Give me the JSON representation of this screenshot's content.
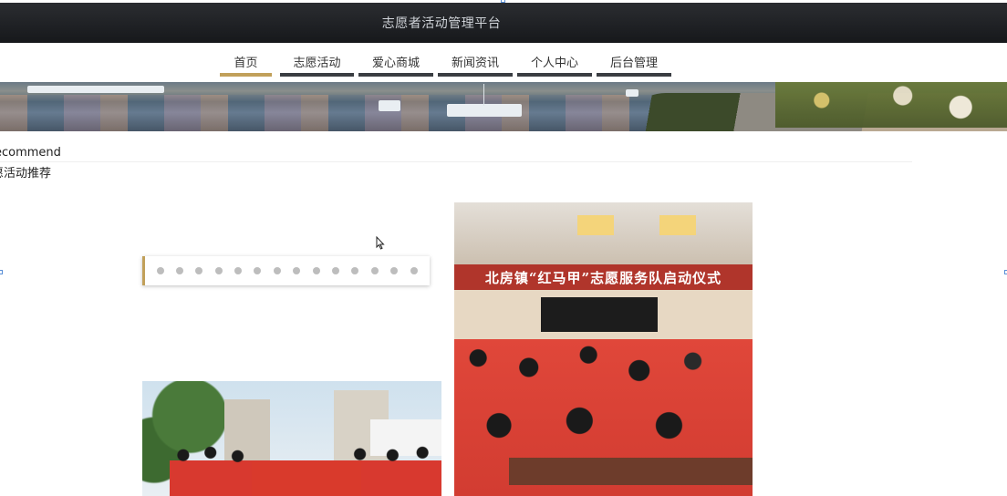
{
  "header": {
    "title": "志愿者活动管理平台"
  },
  "nav": {
    "tabs": [
      {
        "label": "首页",
        "active": true
      },
      {
        "label": "志愿活动",
        "active": false
      },
      {
        "label": "爱心商城",
        "active": false
      },
      {
        "label": "新闻资讯",
        "active": false
      },
      {
        "label": "个人中心",
        "active": false
      },
      {
        "label": "后台管理",
        "active": false
      }
    ]
  },
  "banner": {
    "image": "harbor-sunset-banner"
  },
  "section": {
    "title_en": "ecommend",
    "title_cn": "愿活动推荐"
  },
  "carousel": {
    "dot_count": 14
  },
  "photos": {
    "photo1_banner": "北房镇“红马甲”志愿服务队启动仪式"
  },
  "colors": {
    "accent": "#c1a05a",
    "header_bg": "#1f2125",
    "nav_underline": "#3a3d42"
  }
}
